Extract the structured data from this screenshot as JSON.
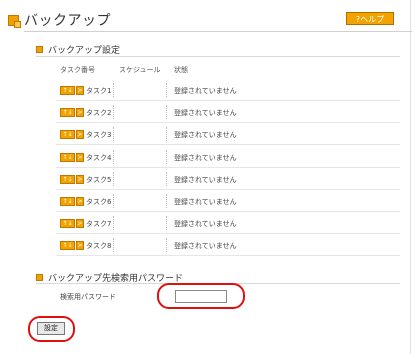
{
  "header": {
    "title": "バックアップ",
    "help_label": "?ヘルプ"
  },
  "backup_settings": {
    "title": "バックアップ設定",
    "columns": [
      "タスク番号",
      "スケジュール",
      "状態"
    ],
    "tasks": [
      {
        "name": "タスク1",
        "schedule": "",
        "status": "登録されていません"
      },
      {
        "name": "タスク2",
        "schedule": "",
        "status": "登録されていません"
      },
      {
        "name": "タスク3",
        "schedule": "",
        "status": "登録されていません"
      },
      {
        "name": "タスク4",
        "schedule": "",
        "status": "登録されていません"
      },
      {
        "name": "タスク5",
        "schedule": "",
        "status": "登録されていません"
      },
      {
        "name": "タスク6",
        "schedule": "",
        "status": "登録されていません"
      },
      {
        "name": "タスク7",
        "schedule": "",
        "status": "登録されていません"
      },
      {
        "name": "タスク8",
        "schedule": "",
        "status": "登録されていません"
      }
    ],
    "task_button_glyph": "↑↓",
    "task_arrow_glyph": ">"
  },
  "search_password": {
    "title": "バックアップ先検索用パスワード",
    "label": "検索用パスワード",
    "value": ""
  },
  "footer": {
    "set_label": "設定"
  },
  "colors": {
    "accent": "#f3a300",
    "highlight": "#e01010"
  }
}
